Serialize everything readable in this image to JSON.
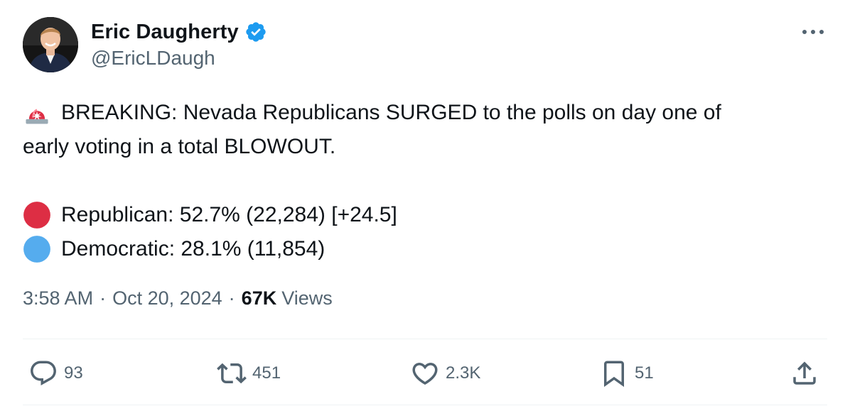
{
  "author": {
    "name": "Eric Daugherty",
    "handle": "@EricLDaugh",
    "verified": true
  },
  "tweet": {
    "lines": [
      {
        "emoji": "rotating-light",
        "text": "BREAKING: Nevada Republicans SURGED to the polls on day one of"
      },
      {
        "text": "early voting in a total BLOWOUT."
      },
      {
        "emoji": "red-circle",
        "text": "Republican: 52.7% (22,284) [+24.5]"
      },
      {
        "emoji": "blue-circle",
        "text": "Democratic: 28.1% (11,854)"
      }
    ]
  },
  "meta": {
    "time": "3:58 AM",
    "separator": "·",
    "date": "Oct 20, 2024",
    "views_count": "67K",
    "views_label": "Views"
  },
  "actions": {
    "reply_count": "93",
    "retweet_count": "451",
    "like_count": "2.3K",
    "bookmark_count": "51"
  },
  "colors": {
    "text_primary": "#0f1419",
    "text_secondary": "#536471",
    "verified_blue": "#1d9bf0",
    "divider": "#eff3f4",
    "red_circle": "#dd2e44",
    "blue_circle": "#55acee"
  }
}
